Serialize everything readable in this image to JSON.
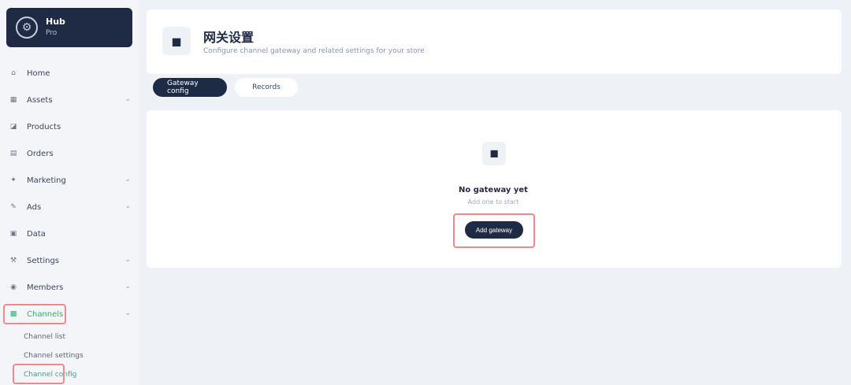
{
  "sidebar": {
    "brand": {
      "title": "Hub",
      "subtitle": "Pro"
    },
    "items": [
      {
        "label": "Home",
        "icon": "home-icon",
        "glyph": "⌂",
        "chevron": false
      },
      {
        "label": "Assets",
        "icon": "folder-icon",
        "glyph": "▦",
        "chevron": true
      },
      {
        "label": "Products",
        "icon": "box-icon",
        "glyph": "◪",
        "chevron": false
      },
      {
        "label": "Orders",
        "icon": "list-icon",
        "glyph": "▤",
        "chevron": false
      },
      {
        "label": "Marketing",
        "icon": "megaphone-icon",
        "glyph": "✦",
        "chevron": true
      },
      {
        "label": "Ads",
        "icon": "edit-icon",
        "glyph": "✎",
        "chevron": true
      },
      {
        "label": "Data",
        "icon": "grid-icon",
        "glyph": "▣",
        "chevron": false
      },
      {
        "label": "Settings",
        "icon": "tool-icon",
        "glyph": "⚒",
        "chevron": true
      },
      {
        "label": "Members",
        "icon": "users-icon",
        "glyph": "◉",
        "chevron": true
      },
      {
        "label": "Channels",
        "icon": "channel-icon",
        "glyph": "▩",
        "chevron": true,
        "active": true
      }
    ],
    "subitems": [
      {
        "label": "Channel list"
      },
      {
        "label": "Channel settings"
      },
      {
        "label": "Channel config",
        "active": true
      }
    ]
  },
  "header": {
    "title": "网关设置",
    "description": "Configure channel gateway and related settings for your store"
  },
  "tabs": [
    {
      "label": "Gateway config",
      "active": true
    },
    {
      "label": "Records",
      "active": false
    }
  ],
  "empty_state": {
    "title": "No gateway yet",
    "subtitle": "Add one to start",
    "button": "Add gateway"
  }
}
